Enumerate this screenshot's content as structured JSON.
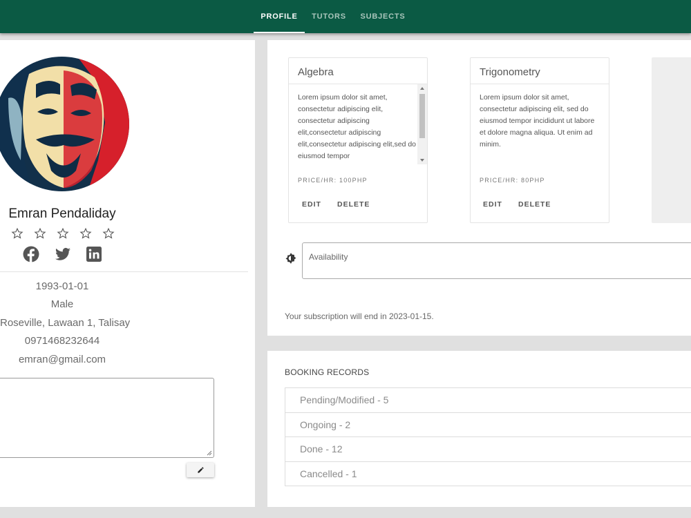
{
  "nav": {
    "tabs": [
      {
        "label": "PROFILE",
        "active": true
      },
      {
        "label": "TUTORS",
        "active": false
      },
      {
        "label": "SUBJECTS",
        "active": false
      }
    ]
  },
  "colors": {
    "brand": "#0b5a44",
    "social": "#555555"
  },
  "profile": {
    "name": "Emran Pendaliday",
    "rating": 0,
    "rating_max": 5,
    "socials": [
      "facebook-icon",
      "twitter-icon",
      "linkedin-icon"
    ],
    "birthdate": "1993-01-01",
    "gender": "Male",
    "address": "Roseville, Lawaan 1, Talisay",
    "phone": "0971468232644",
    "email": "emran@gmail.com",
    "notes": ""
  },
  "subjects": [
    {
      "title": "Algebra",
      "description": "Lorem ipsum dolor sit amet, consectetur adipiscing elit, consectetur adipiscing elit,consectetur adipiscing elit,consectetur adipiscing elit,sed do eiusmod tempor",
      "price": "PRICE/HR: 100PHP",
      "edit_label": "EDIT",
      "delete_label": "DELETE"
    },
    {
      "title": "Trigonometry",
      "description": "Lorem ipsum dolor sit amet, consectetur adipiscing elit, sed do eiusmod tempor incididunt ut labore et dolore magna aliqua. Ut enim ad minim.",
      "price": "PRICE/HR: 80PHP",
      "edit_label": "EDIT",
      "delete_label": "DELETE"
    }
  ],
  "availability": {
    "label": "Availability",
    "value": ""
  },
  "subscription_text": "Your subscription will end in 2023-01-15.",
  "booking": {
    "title": "BOOKING RECORDS",
    "items": [
      {
        "label": "Pending/Modified - 5"
      },
      {
        "label": "Ongoing - 2"
      },
      {
        "label": "Done - 12"
      },
      {
        "label": "Cancelled - 1"
      }
    ]
  }
}
